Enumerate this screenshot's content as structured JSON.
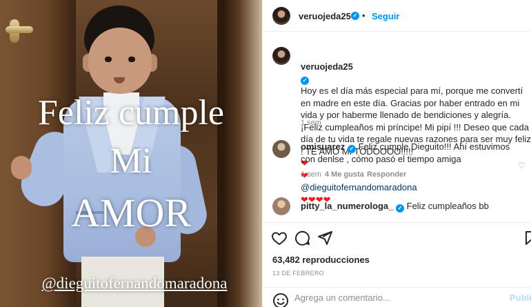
{
  "media": {
    "overlay_line1": "Feliz cumple",
    "overlay_line2": "Mi",
    "overlay_line3": "AMOR",
    "overlay_handle": "@dieguitofernandomaradona"
  },
  "header": {
    "username": "veruojeda25",
    "separator": "•",
    "follow_label": "Seguir",
    "more_icon": "more-horizontal-icon"
  },
  "caption": {
    "username": "veruojeda25",
    "text_main": "Hoy es el día más especial para mí, porque me convertí en madre en este día. Gracias por haber entrado en mi vida y por haberme llenado de bendiciones y alegría. ¡Feliz cumpleaños mi príncipe! Mi pipí !!! Deseo que cada día de tu vida te regale nuevas razones para ser muy feliz ! TE AMO MI TODOOOO!!!!!",
    "hearts_a": "❤",
    "hearts_b": "❤",
    "mention": "@dieguitofernandomaradona",
    "hearts_c": "❤❤❤❤",
    "time": "1 sem"
  },
  "comments": [
    {
      "username": "omisuarez",
      "text": "Feliz cumple Dieguito!!! Ahí estuvimos con denlse , cómo pasó el tiempo amiga",
      "time": "1 sem",
      "likes": "4 Me gusta",
      "reply": "Responder"
    },
    {
      "username": "pitty_la_numerologa_",
      "text": "Feliz cumpleaños bb"
    }
  ],
  "actions": {
    "like_icon": "heart-outline-icon",
    "comment_icon": "comment-icon",
    "share_icon": "send-icon",
    "save_icon": "bookmark-icon",
    "views": "63,482 reproducciones",
    "date": "13 DE FEBRERO"
  },
  "comment_box": {
    "emoji_icon": "emoji-icon",
    "placeholder": "Agrega un comentario...",
    "publish_label": "Publicar"
  },
  "colors": {
    "accent": "#0095f6",
    "heart": "#ed1c24",
    "mention": "#00376b",
    "muted": "#8e8e8e"
  }
}
